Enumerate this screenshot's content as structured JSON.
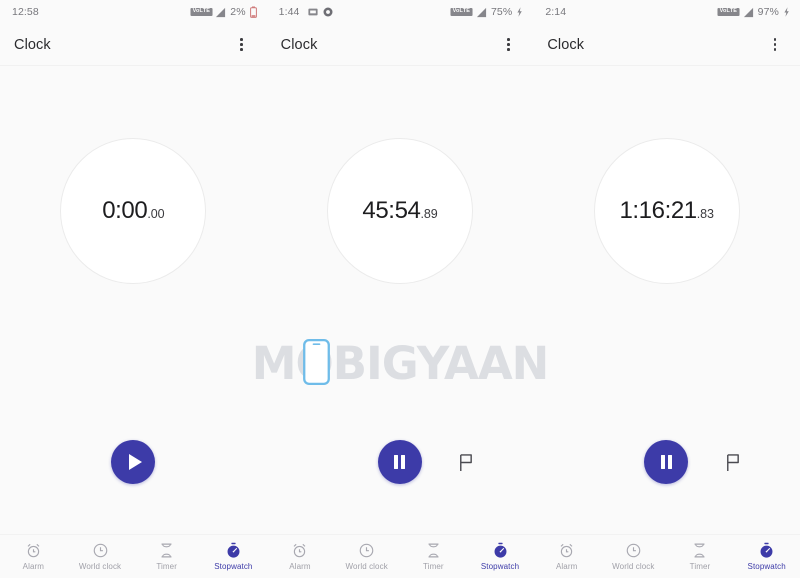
{
  "app": {
    "title": "Clock",
    "accent_color": "#3d3ba8",
    "background_color": "#fafafa",
    "dial_color": "#ffffff",
    "inactive_nav_color": "#a0a0a8"
  },
  "watermark": {
    "text": "MOBIGYAAN",
    "phone_icon_color": "#66b8e8"
  },
  "bottom_nav": {
    "items": [
      {
        "label": "Alarm",
        "icon": "alarm-clock-icon",
        "active": false
      },
      {
        "label": "World clock",
        "icon": "globe-clock-icon",
        "active": false
      },
      {
        "label": "Timer",
        "icon": "hourglass-icon",
        "active": false
      },
      {
        "label": "Stopwatch",
        "icon": "stopwatch-icon",
        "active": true
      }
    ]
  },
  "panels": [
    {
      "status": {
        "time": "12:58",
        "notifications": [],
        "network_badge": "VoLTE",
        "signal_icon": "signal-bars-icon",
        "battery_text": "2%",
        "battery_icon": "battery-low-icon",
        "charging": false
      },
      "toolbar": {
        "title": "Clock",
        "overflow": "overflow-menu-icon"
      },
      "stopwatch": {
        "main_time": "0:00",
        "fraction": ".00",
        "state": "stopped",
        "primary_button": {
          "icon": "play-icon",
          "label": "Start"
        },
        "lap_button_visible": false
      }
    },
    {
      "status": {
        "time": "1:44",
        "notifications": [
          "screenshot-icon",
          "app-badge-icon"
        ],
        "network_badge": "VoLTE",
        "signal_icon": "signal-bars-icon",
        "battery_text": "75%",
        "battery_icon": "battery-charging-icon",
        "charging": true
      },
      "toolbar": {
        "title": "Clock",
        "overflow": "overflow-menu-icon"
      },
      "stopwatch": {
        "main_time": "45:54",
        "fraction": ".89",
        "state": "running",
        "primary_button": {
          "icon": "pause-icon",
          "label": "Pause"
        },
        "lap_button_visible": true,
        "lap_button": {
          "icon": "flag-icon",
          "label": "Lap"
        }
      }
    },
    {
      "status": {
        "time": "2:14",
        "notifications": [],
        "network_badge": "VoLTE",
        "signal_icon": "signal-bars-icon",
        "battery_text": "97%",
        "battery_icon": "battery-charging-icon",
        "charging": true
      },
      "toolbar": {
        "title": "Clock",
        "overflow": "overflow-menu-icon"
      },
      "stopwatch": {
        "main_time": "1:16:21",
        "fraction": ".83",
        "state": "running",
        "primary_button": {
          "icon": "pause-icon",
          "label": "Pause"
        },
        "lap_button_visible": true,
        "lap_button": {
          "icon": "flag-icon",
          "label": "Lap"
        }
      }
    }
  ]
}
